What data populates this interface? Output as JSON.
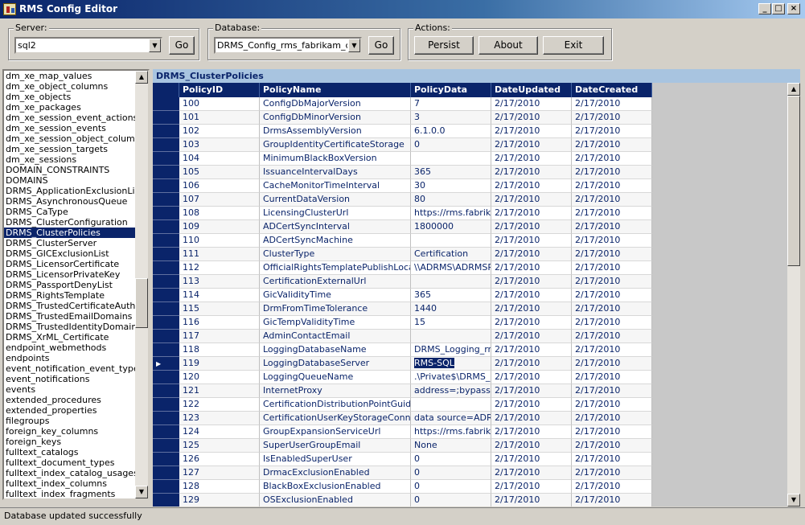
{
  "window": {
    "title": "RMS Config Editor"
  },
  "server": {
    "label": "Server:",
    "value": "sql2",
    "go_label": "Go"
  },
  "database": {
    "label": "Database:",
    "value": "DRMS_Config_rms_fabrikam_com",
    "go_label": "Go"
  },
  "actions": {
    "label": "Actions:",
    "persist_label": "Persist",
    "about_label": "About",
    "exit_label": "Exit"
  },
  "tables": [
    "dm_xe_map_values",
    "dm_xe_object_columns",
    "dm_xe_objects",
    "dm_xe_packages",
    "dm_xe_session_event_actions",
    "dm_xe_session_events",
    "dm_xe_session_object_columns",
    "dm_xe_session_targets",
    "dm_xe_sessions",
    "DOMAIN_CONSTRAINTS",
    "DOMAINS",
    "DRMS_ApplicationExclusionList",
    "DRMS_AsynchronousQueue",
    "DRMS_CaType",
    "DRMS_ClusterConfiguration",
    "DRMS_ClusterPolicies",
    "DRMS_ClusterServer",
    "DRMS_GICExclusionList",
    "DRMS_LicensorCertificate",
    "DRMS_LicensorPrivateKey",
    "DRMS_PassportDenyList",
    "DRMS_RightsTemplate",
    "DRMS_TrustedCertificateAuthoritie",
    "DRMS_TrustedEmailDomains",
    "DRMS_TrustedIdentityDomain",
    "DRMS_XrML_Certificate",
    "endpoint_webmethods",
    "endpoints",
    "event_notification_event_types",
    "event_notifications",
    "events",
    "extended_procedures",
    "extended_properties",
    "filegroups",
    "foreign_key_columns",
    "foreign_keys",
    "fulltext_catalogs",
    "fulltext_document_types",
    "fulltext_index_catalog_usages",
    "fulltext_index_columns",
    "fulltext_index_fragments"
  ],
  "selected_table": "DRMS_ClusterPolicies",
  "grid": {
    "caption": "DRMS_ClusterPolicies",
    "columns": [
      "PolicyID",
      "PolicyName",
      "PolicyData",
      "DateUpdated",
      "DateCreated"
    ],
    "current_row_index": 19,
    "rows": [
      [
        "100",
        "ConfigDbMajorVersion",
        "7",
        "2/17/2010",
        "2/17/2010"
      ],
      [
        "101",
        "ConfigDbMinorVersion",
        "3",
        "2/17/2010",
        "2/17/2010"
      ],
      [
        "102",
        "DrmsAssemblyVersion",
        "6.1.0.0",
        "2/17/2010",
        "2/17/2010"
      ],
      [
        "103",
        "GroupIdentityCertificateStorage",
        "0",
        "2/17/2010",
        "2/17/2010"
      ],
      [
        "104",
        "MinimumBlackBoxVersion",
        "",
        "2/17/2010",
        "2/17/2010"
      ],
      [
        "105",
        "IssuanceIntervalDays",
        "365",
        "2/17/2010",
        "2/17/2010"
      ],
      [
        "106",
        "CacheMonitorTimeInterval",
        "30",
        "2/17/2010",
        "2/17/2010"
      ],
      [
        "107",
        "CurrentDataVersion",
        "80",
        "2/17/2010",
        "2/17/2010"
      ],
      [
        "108",
        "LicensingClusterUrl",
        "https://rms.fabrika",
        "2/17/2010",
        "2/17/2010"
      ],
      [
        "109",
        "ADCertSyncInterval",
        "1800000",
        "2/17/2010",
        "2/17/2010"
      ],
      [
        "110",
        "ADCertSyncMachine",
        "",
        "2/17/2010",
        "2/17/2010"
      ],
      [
        "111",
        "ClusterType",
        "Certification",
        "2/17/2010",
        "2/17/2010"
      ],
      [
        "112",
        "OfficialRightsTemplatePublishLocation",
        "\\\\ADRMS\\ADRMSP",
        "2/17/2010",
        "2/17/2010"
      ],
      [
        "113",
        "CertificationExternalUrl",
        "",
        "2/17/2010",
        "2/17/2010"
      ],
      [
        "114",
        "GicValidityTime",
        "365",
        "2/17/2010",
        "2/17/2010"
      ],
      [
        "115",
        "DrmFromTimeTolerance",
        "1440",
        "2/17/2010",
        "2/17/2010"
      ],
      [
        "116",
        "GicTempValidityTime",
        "15",
        "2/17/2010",
        "2/17/2010"
      ],
      [
        "117",
        "AdminContactEmail",
        "",
        "2/17/2010",
        "2/17/2010"
      ],
      [
        "118",
        "LoggingDatabaseName",
        "DRMS_Logging_rm",
        "2/17/2010",
        "2/17/2010"
      ],
      [
        "119",
        "LoggingDatabaseServer",
        "RMS-SQL",
        "2/17/2010",
        "2/17/2010"
      ],
      [
        "120",
        "LoggingQueueName",
        ".\\Private$\\DRMS_L",
        "2/17/2010",
        "2/17/2010"
      ],
      [
        "121",
        "InternetProxy",
        "address=;bypassLis",
        "2/17/2010",
        "2/17/2010"
      ],
      [
        "122",
        "CertificationDistributionPointGuid",
        "",
        "2/17/2010",
        "2/17/2010"
      ],
      [
        "123",
        "CertificationUserKeyStorageConnectio",
        "data source=ADRM",
        "2/17/2010",
        "2/17/2010"
      ],
      [
        "124",
        "GroupExpansionServiceUrl",
        "https://rms.fabrika",
        "2/17/2010",
        "2/17/2010"
      ],
      [
        "125",
        "SuperUserGroupEmail",
        "None",
        "2/17/2010",
        "2/17/2010"
      ],
      [
        "126",
        "IsEnabledSuperUser",
        "0",
        "2/17/2010",
        "2/17/2010"
      ],
      [
        "127",
        "DrmacExclusionEnabled",
        "0",
        "2/17/2010",
        "2/17/2010"
      ],
      [
        "128",
        "BlackBoxExclusionEnabled",
        "0",
        "2/17/2010",
        "2/17/2010"
      ],
      [
        "129",
        "OSExclusionEnabled",
        "0",
        "2/17/2010",
        "2/17/2010"
      ]
    ]
  },
  "status": {
    "text": "Database updated successfully"
  },
  "icons": {
    "app": "app-icon",
    "minimize": "minimize-icon",
    "maximize": "maximize-icon",
    "close": "close-icon",
    "dropdown": "chevron-down-icon",
    "scroll_up": "scroll-up-icon",
    "scroll_down": "scroll-down-icon",
    "current_row": "current-row-arrow-icon"
  },
  "colors": {
    "selection": "#0a246a",
    "header": "#0a246a",
    "caption": "#a8c4e0",
    "window_bg": "#d4d0c8"
  }
}
